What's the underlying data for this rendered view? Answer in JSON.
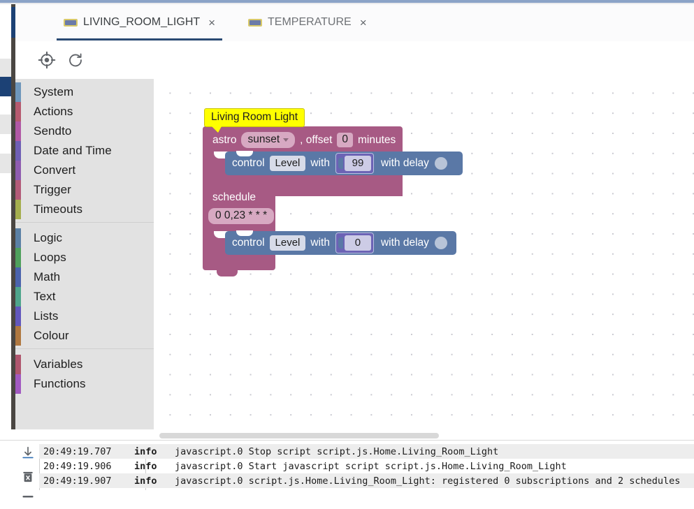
{
  "window": {
    "back_label": "back-arrow"
  },
  "tabs": [
    {
      "label": "LIVING_ROOM_LIGHT",
      "icon": "blockly-icon",
      "close": "×",
      "active": true
    },
    {
      "label": "TEMPERATURE",
      "icon": "blockly-icon",
      "close": "×",
      "active": false
    }
  ],
  "toolbar": {
    "center_label": "center-blocks-icon",
    "reload_label": "reload-icon"
  },
  "sidebar": {
    "groups": [
      {
        "items": [
          {
            "label": "System",
            "color": "#6e96bb"
          },
          {
            "label": "Actions",
            "color": "#b65a6f"
          },
          {
            "label": "Sendto",
            "color": "#b158a5"
          },
          {
            "label": "Date and Time",
            "color": "#6f5fb5"
          },
          {
            "label": "Convert",
            "color": "#8f5cb0"
          },
          {
            "label": "Trigger",
            "color": "#b35b78"
          },
          {
            "label": "Timeouts",
            "color": "#a5ae4e"
          }
        ]
      },
      {
        "items": [
          {
            "label": "Logic",
            "color": "#5b80a5"
          },
          {
            "label": "Loops",
            "color": "#4fa05c"
          },
          {
            "label": "Math",
            "color": "#4b63ad"
          },
          {
            "label": "Text",
            "color": "#4fa58c"
          },
          {
            "label": "Lists",
            "color": "#6257bd"
          },
          {
            "label": "Colour",
            "color": "#b07840"
          }
        ]
      },
      {
        "items": [
          {
            "label": "Variables",
            "color": "#b0566e"
          },
          {
            "label": "Functions",
            "color": "#a259c1"
          }
        ]
      }
    ]
  },
  "workspace": {
    "comment": {
      "text": "Living Room Light"
    },
    "script1": {
      "trigger_word": "astro",
      "astro_event": "sunset",
      "offset_label": ", offset",
      "offset_value": "0",
      "minutes_label": "minutes",
      "action": {
        "verb": "control",
        "target": "Level",
        "with_label": "with",
        "value": "99",
        "delay_label": "with delay",
        "delay_value": ""
      }
    },
    "script2": {
      "trigger_word": "schedule",
      "cron": "0 0,23 * * *",
      "action": {
        "verb": "control",
        "target": "Level",
        "with_label": "with",
        "value": "0",
        "delay_label": "with delay",
        "delay_value": ""
      }
    }
  },
  "log": {
    "icons": {
      "export": "download-icon",
      "clear": "trash-icon"
    },
    "rows": [
      {
        "time": "20:49:19.707",
        "severity": "info",
        "message": "javascript.0 Stop script script.js.Home.Living_Room_Light"
      },
      {
        "time": "20:49:19.906",
        "severity": "info",
        "message": "javascript.0 Start javascript script script.js.Home.Living_Room_Light"
      },
      {
        "time": "20:49:19.907",
        "severity": "info",
        "message": "javascript.0 script.js.Home.Living_Room_Light: registered 0 subscriptions and 2 schedules"
      }
    ]
  },
  "colors": {
    "accent": "#1c4175",
    "trigger_block": "#a75a84",
    "action_block": "#5a78a6",
    "comment": "#ffff00"
  }
}
